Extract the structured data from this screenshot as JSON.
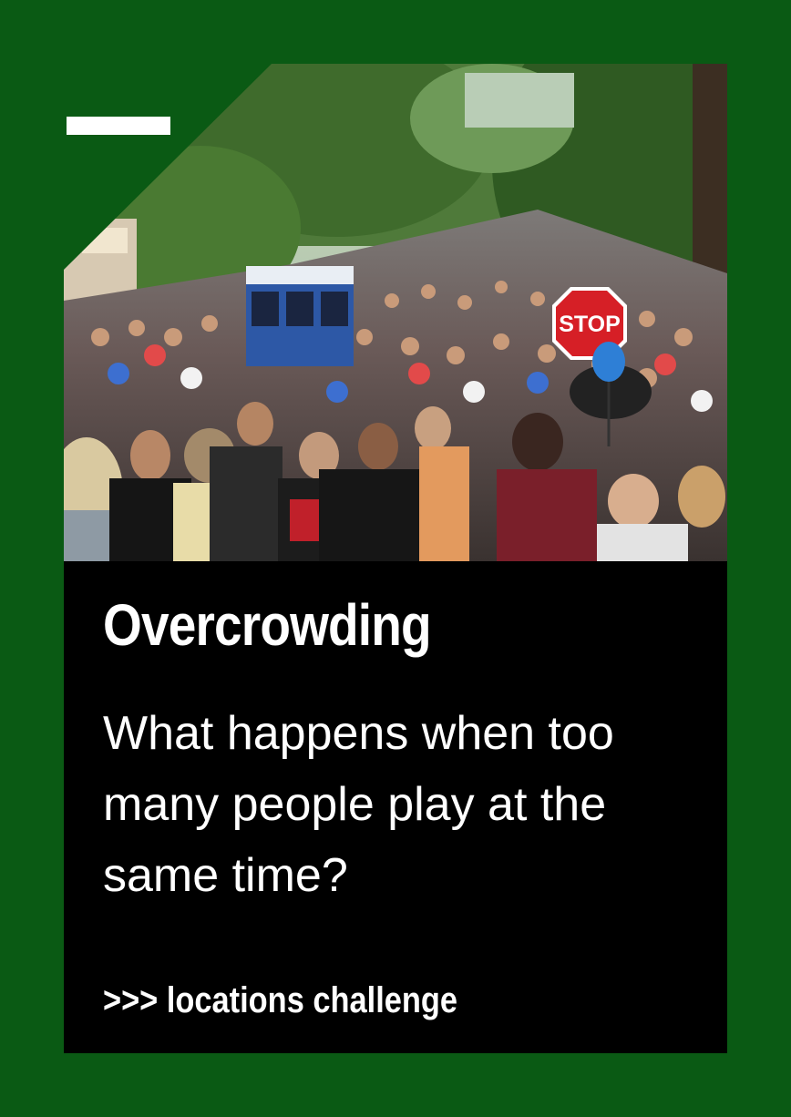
{
  "card": {
    "title": "Overcrowding",
    "question": "What happens when too many people play at the same time?",
    "cta": ">>> locations challenge"
  },
  "photo": {
    "subject": "crowd-at-fair",
    "sign_text": "STOP"
  },
  "colors": {
    "frame_green": "#0a5a14",
    "panel_black": "#000000",
    "text_white": "#ffffff",
    "stop_red": "#d61f26",
    "balloon_blue": "#2e7fd6"
  }
}
